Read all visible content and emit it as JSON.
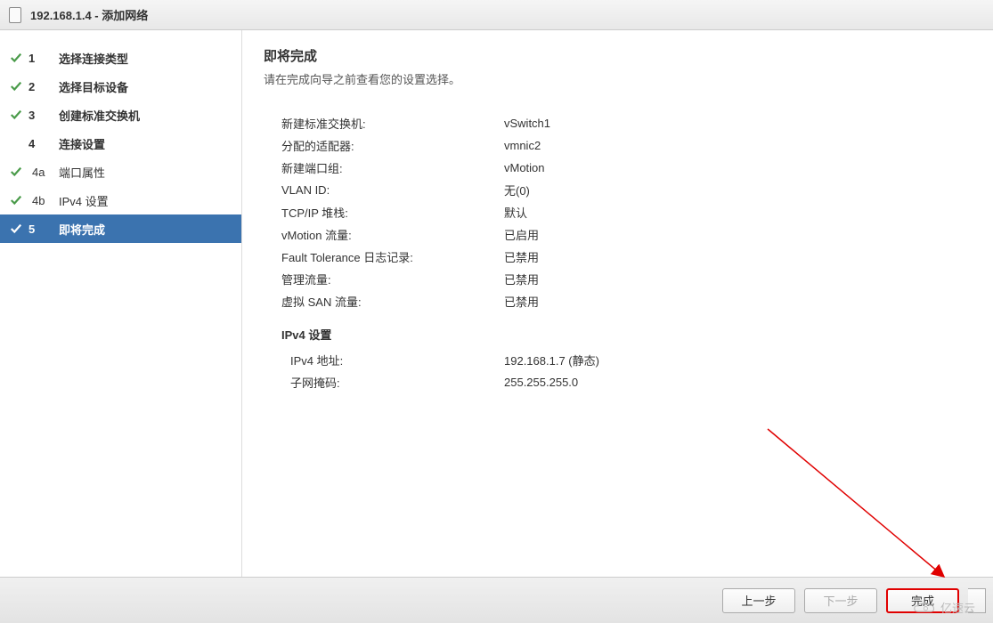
{
  "window": {
    "title": "192.168.1.4 - 添加网络"
  },
  "sidebar": {
    "steps": [
      {
        "num": "1",
        "label": "选择连接类型",
        "done": true,
        "active": false,
        "sub": false
      },
      {
        "num": "2",
        "label": "选择目标设备",
        "done": true,
        "active": false,
        "sub": false
      },
      {
        "num": "3",
        "label": "创建标准交换机",
        "done": true,
        "active": false,
        "sub": false
      },
      {
        "num": "4",
        "label": "连接设置",
        "done": false,
        "active": false,
        "sub": false
      },
      {
        "num": "4a",
        "label": "端口属性",
        "done": true,
        "active": false,
        "sub": true
      },
      {
        "num": "4b",
        "label": "IPv4 设置",
        "done": true,
        "active": false,
        "sub": true
      },
      {
        "num": "5",
        "label": "即将完成",
        "done": true,
        "active": true,
        "sub": false
      }
    ]
  },
  "content": {
    "title": "即将完成",
    "subtitle": "请在完成向导之前查看您的设置选择。",
    "summary": [
      {
        "label": "新建标准交换机:",
        "value": "vSwitch1"
      },
      {
        "label": "分配的适配器:",
        "value": "vmnic2"
      },
      {
        "label": "新建端口组:",
        "value": "vMotion"
      },
      {
        "label": "VLAN ID:",
        "value": "无(0)"
      },
      {
        "label": "TCP/IP 堆栈:",
        "value": "默认"
      },
      {
        "label": "vMotion 流量:",
        "value": "已启用"
      },
      {
        "label": "Fault Tolerance 日志记录:",
        "value": "已禁用"
      },
      {
        "label": "管理流量:",
        "value": "已禁用"
      },
      {
        "label": "虚拟 SAN 流量:",
        "value": "已禁用"
      }
    ],
    "ipv4_header": "IPv4 设置",
    "ipv4": [
      {
        "label": "IPv4 地址:",
        "value": "192.168.1.7 (静态)"
      },
      {
        "label": "子网掩码:",
        "value": "255.255.255.0"
      }
    ]
  },
  "footer": {
    "back": "上一步",
    "next": "下一步",
    "finish": "完成"
  },
  "watermark": "亿速云"
}
